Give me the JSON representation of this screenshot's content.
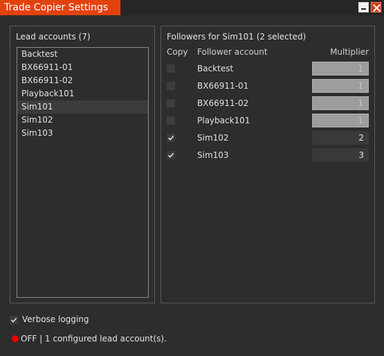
{
  "window": {
    "title": "Trade Copier Settings"
  },
  "lead": {
    "title": "Lead accounts (7)",
    "items": [
      "Backtest",
      "BX66911-01",
      "BX66911-02",
      "Playback101",
      "Sim101",
      "Sim102",
      "Sim103"
    ],
    "selected_index": 4
  },
  "followers": {
    "title": "Followers for Sim101 (2 selected)",
    "headers": {
      "copy": "Copy",
      "account": "Follower account",
      "multiplier": "Multiplier"
    },
    "rows": [
      {
        "account": "Backtest",
        "checked": false,
        "multiplier": "1",
        "enabled": false
      },
      {
        "account": "BX66911-01",
        "checked": false,
        "multiplier": "1",
        "enabled": false
      },
      {
        "account": "BX66911-02",
        "checked": false,
        "multiplier": "1",
        "enabled": false
      },
      {
        "account": "Playback101",
        "checked": false,
        "multiplier": "1",
        "enabled": false
      },
      {
        "account": "Sim102",
        "checked": true,
        "multiplier": "2",
        "enabled": true
      },
      {
        "account": "Sim103",
        "checked": true,
        "multiplier": "3",
        "enabled": true
      }
    ]
  },
  "options": {
    "verbose_label": "Verbose logging",
    "verbose_checked": true
  },
  "status": {
    "text": "OFF | 1 configured lead account(s).",
    "color": "#e50000"
  },
  "colors": {
    "accent": "#e3420f",
    "background": "#2d2d2d"
  }
}
